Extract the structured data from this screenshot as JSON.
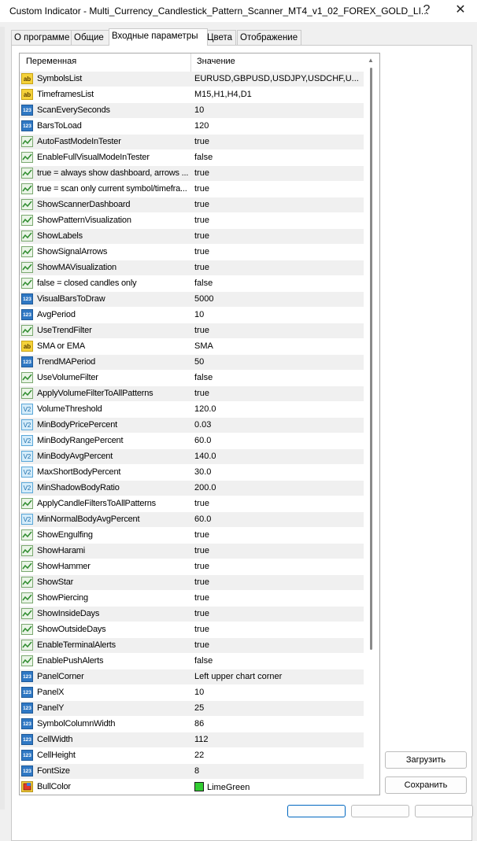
{
  "window": {
    "title": "Custom Indicator - Multi_Currency_Candlestick_Pattern_Scanner_MT4_v1_02_FOREX_GOLD_LI...",
    "help_label": "?",
    "close_label": "✕"
  },
  "tabs": [
    {
      "label": "О программе"
    },
    {
      "label": "Общие"
    },
    {
      "label": "Входные параметры"
    },
    {
      "label": "Цвета"
    },
    {
      "label": "Отображение"
    }
  ],
  "grid": {
    "header_variable": "Переменная",
    "header_value": "Значение"
  },
  "params": [
    {
      "type": "ab",
      "icon": "string-type-icon",
      "name": "SymbolsList",
      "value": "EURUSD,GBPUSD,USDJPY,USDCHF,U..."
    },
    {
      "type": "ab",
      "icon": "string-type-icon",
      "name": "TimeframesList",
      "value": "M15,H1,H4,D1"
    },
    {
      "type": "123",
      "icon": "integer-type-icon",
      "name": "ScanEverySeconds",
      "value": "10"
    },
    {
      "type": "123",
      "icon": "integer-type-icon",
      "name": "BarsToLoad",
      "value": "120"
    },
    {
      "type": "bool",
      "icon": "boolean-type-icon",
      "name": "AutoFastModeInTester",
      "value": "true"
    },
    {
      "type": "bool",
      "icon": "boolean-type-icon",
      "name": "EnableFullVisualModeInTester",
      "value": "false"
    },
    {
      "type": "bool",
      "icon": "boolean-type-icon",
      "name": "true = always show dashboard, arrows ...",
      "value": "true"
    },
    {
      "type": "bool",
      "icon": "boolean-type-icon",
      "name": "true = scan only current symbol/timefra...",
      "value": "true"
    },
    {
      "type": "bool",
      "icon": "boolean-type-icon",
      "name": "ShowScannerDashboard",
      "value": "true"
    },
    {
      "type": "bool",
      "icon": "boolean-type-icon",
      "name": "ShowPatternVisualization",
      "value": "true"
    },
    {
      "type": "bool",
      "icon": "boolean-type-icon",
      "name": "ShowLabels",
      "value": "true"
    },
    {
      "type": "bool",
      "icon": "boolean-type-icon",
      "name": "ShowSignalArrows",
      "value": "true"
    },
    {
      "type": "bool",
      "icon": "boolean-type-icon",
      "name": "ShowMAVisualization",
      "value": "true"
    },
    {
      "type": "bool",
      "icon": "boolean-type-icon",
      "name": "false = closed candles only",
      "value": "false"
    },
    {
      "type": "123",
      "icon": "integer-type-icon",
      "name": "VisualBarsToDraw",
      "value": "5000"
    },
    {
      "type": "123",
      "icon": "integer-type-icon",
      "name": "AvgPeriod",
      "value": "10"
    },
    {
      "type": "bool",
      "icon": "boolean-type-icon",
      "name": "UseTrendFilter",
      "value": "true"
    },
    {
      "type": "ab",
      "icon": "string-type-icon",
      "name": "SMA or EMA",
      "value": "SMA"
    },
    {
      "type": "123",
      "icon": "integer-type-icon",
      "name": "TrendMAPeriod",
      "value": "50"
    },
    {
      "type": "bool",
      "icon": "boolean-type-icon",
      "name": "UseVolumeFilter",
      "value": "false"
    },
    {
      "type": "bool",
      "icon": "boolean-type-icon",
      "name": "ApplyVolumeFilterToAllPatterns",
      "value": "true"
    },
    {
      "type": "dbl",
      "icon": "double-type-icon",
      "name": "VolumeThreshold",
      "value": "120.0"
    },
    {
      "type": "dbl",
      "icon": "double-type-icon",
      "name": "MinBodyPricePercent",
      "value": "0.03"
    },
    {
      "type": "dbl",
      "icon": "double-type-icon",
      "name": "MinBodyRangePercent",
      "value": "60.0"
    },
    {
      "type": "dbl",
      "icon": "double-type-icon",
      "name": "MinBodyAvgPercent",
      "value": "140.0"
    },
    {
      "type": "dbl",
      "icon": "double-type-icon",
      "name": "MaxShortBodyPercent",
      "value": "30.0"
    },
    {
      "type": "dbl",
      "icon": "double-type-icon",
      "name": "MinShadowBodyRatio",
      "value": "200.0"
    },
    {
      "type": "bool",
      "icon": "boolean-type-icon",
      "name": "ApplyCandleFiltersToAllPatterns",
      "value": "true"
    },
    {
      "type": "dbl",
      "icon": "double-type-icon",
      "name": "MinNormalBodyAvgPercent",
      "value": "60.0"
    },
    {
      "type": "bool",
      "icon": "boolean-type-icon",
      "name": "ShowEngulfing",
      "value": "true"
    },
    {
      "type": "bool",
      "icon": "boolean-type-icon",
      "name": "ShowHarami",
      "value": "true"
    },
    {
      "type": "bool",
      "icon": "boolean-type-icon",
      "name": "ShowHammer",
      "value": "true"
    },
    {
      "type": "bool",
      "icon": "boolean-type-icon",
      "name": "ShowStar",
      "value": "true"
    },
    {
      "type": "bool",
      "icon": "boolean-type-icon",
      "name": "ShowPiercing",
      "value": "true"
    },
    {
      "type": "bool",
      "icon": "boolean-type-icon",
      "name": "ShowInsideDays",
      "value": "true"
    },
    {
      "type": "bool",
      "icon": "boolean-type-icon",
      "name": "ShowOutsideDays",
      "value": "true"
    },
    {
      "type": "bool",
      "icon": "boolean-type-icon",
      "name": "EnableTerminalAlerts",
      "value": "true"
    },
    {
      "type": "bool",
      "icon": "boolean-type-icon",
      "name": "EnablePushAlerts",
      "value": "false"
    },
    {
      "type": "123",
      "icon": "integer-type-icon",
      "name": "PanelCorner",
      "value": "Left upper chart corner"
    },
    {
      "type": "123",
      "icon": "integer-type-icon",
      "name": "PanelX",
      "value": "10"
    },
    {
      "type": "123",
      "icon": "integer-type-icon",
      "name": "PanelY",
      "value": "25"
    },
    {
      "type": "123",
      "icon": "integer-type-icon",
      "name": "SymbolColumnWidth",
      "value": "86"
    },
    {
      "type": "123",
      "icon": "integer-type-icon",
      "name": "CellWidth",
      "value": "112"
    },
    {
      "type": "123",
      "icon": "integer-type-icon",
      "name": "CellHeight",
      "value": "22"
    },
    {
      "type": "123",
      "icon": "integer-type-icon",
      "name": "FontSize",
      "value": "8"
    },
    {
      "type": "color",
      "icon": "color-type-icon",
      "name": "BullColor",
      "value": "LimeGreen",
      "swatch": "#32cd32"
    }
  ],
  "buttons": {
    "load": "Загрузить",
    "save": "Сохранить"
  },
  "icons": {
    "string_label": "ab",
    "integer_label": "123",
    "double_label": "V2"
  }
}
